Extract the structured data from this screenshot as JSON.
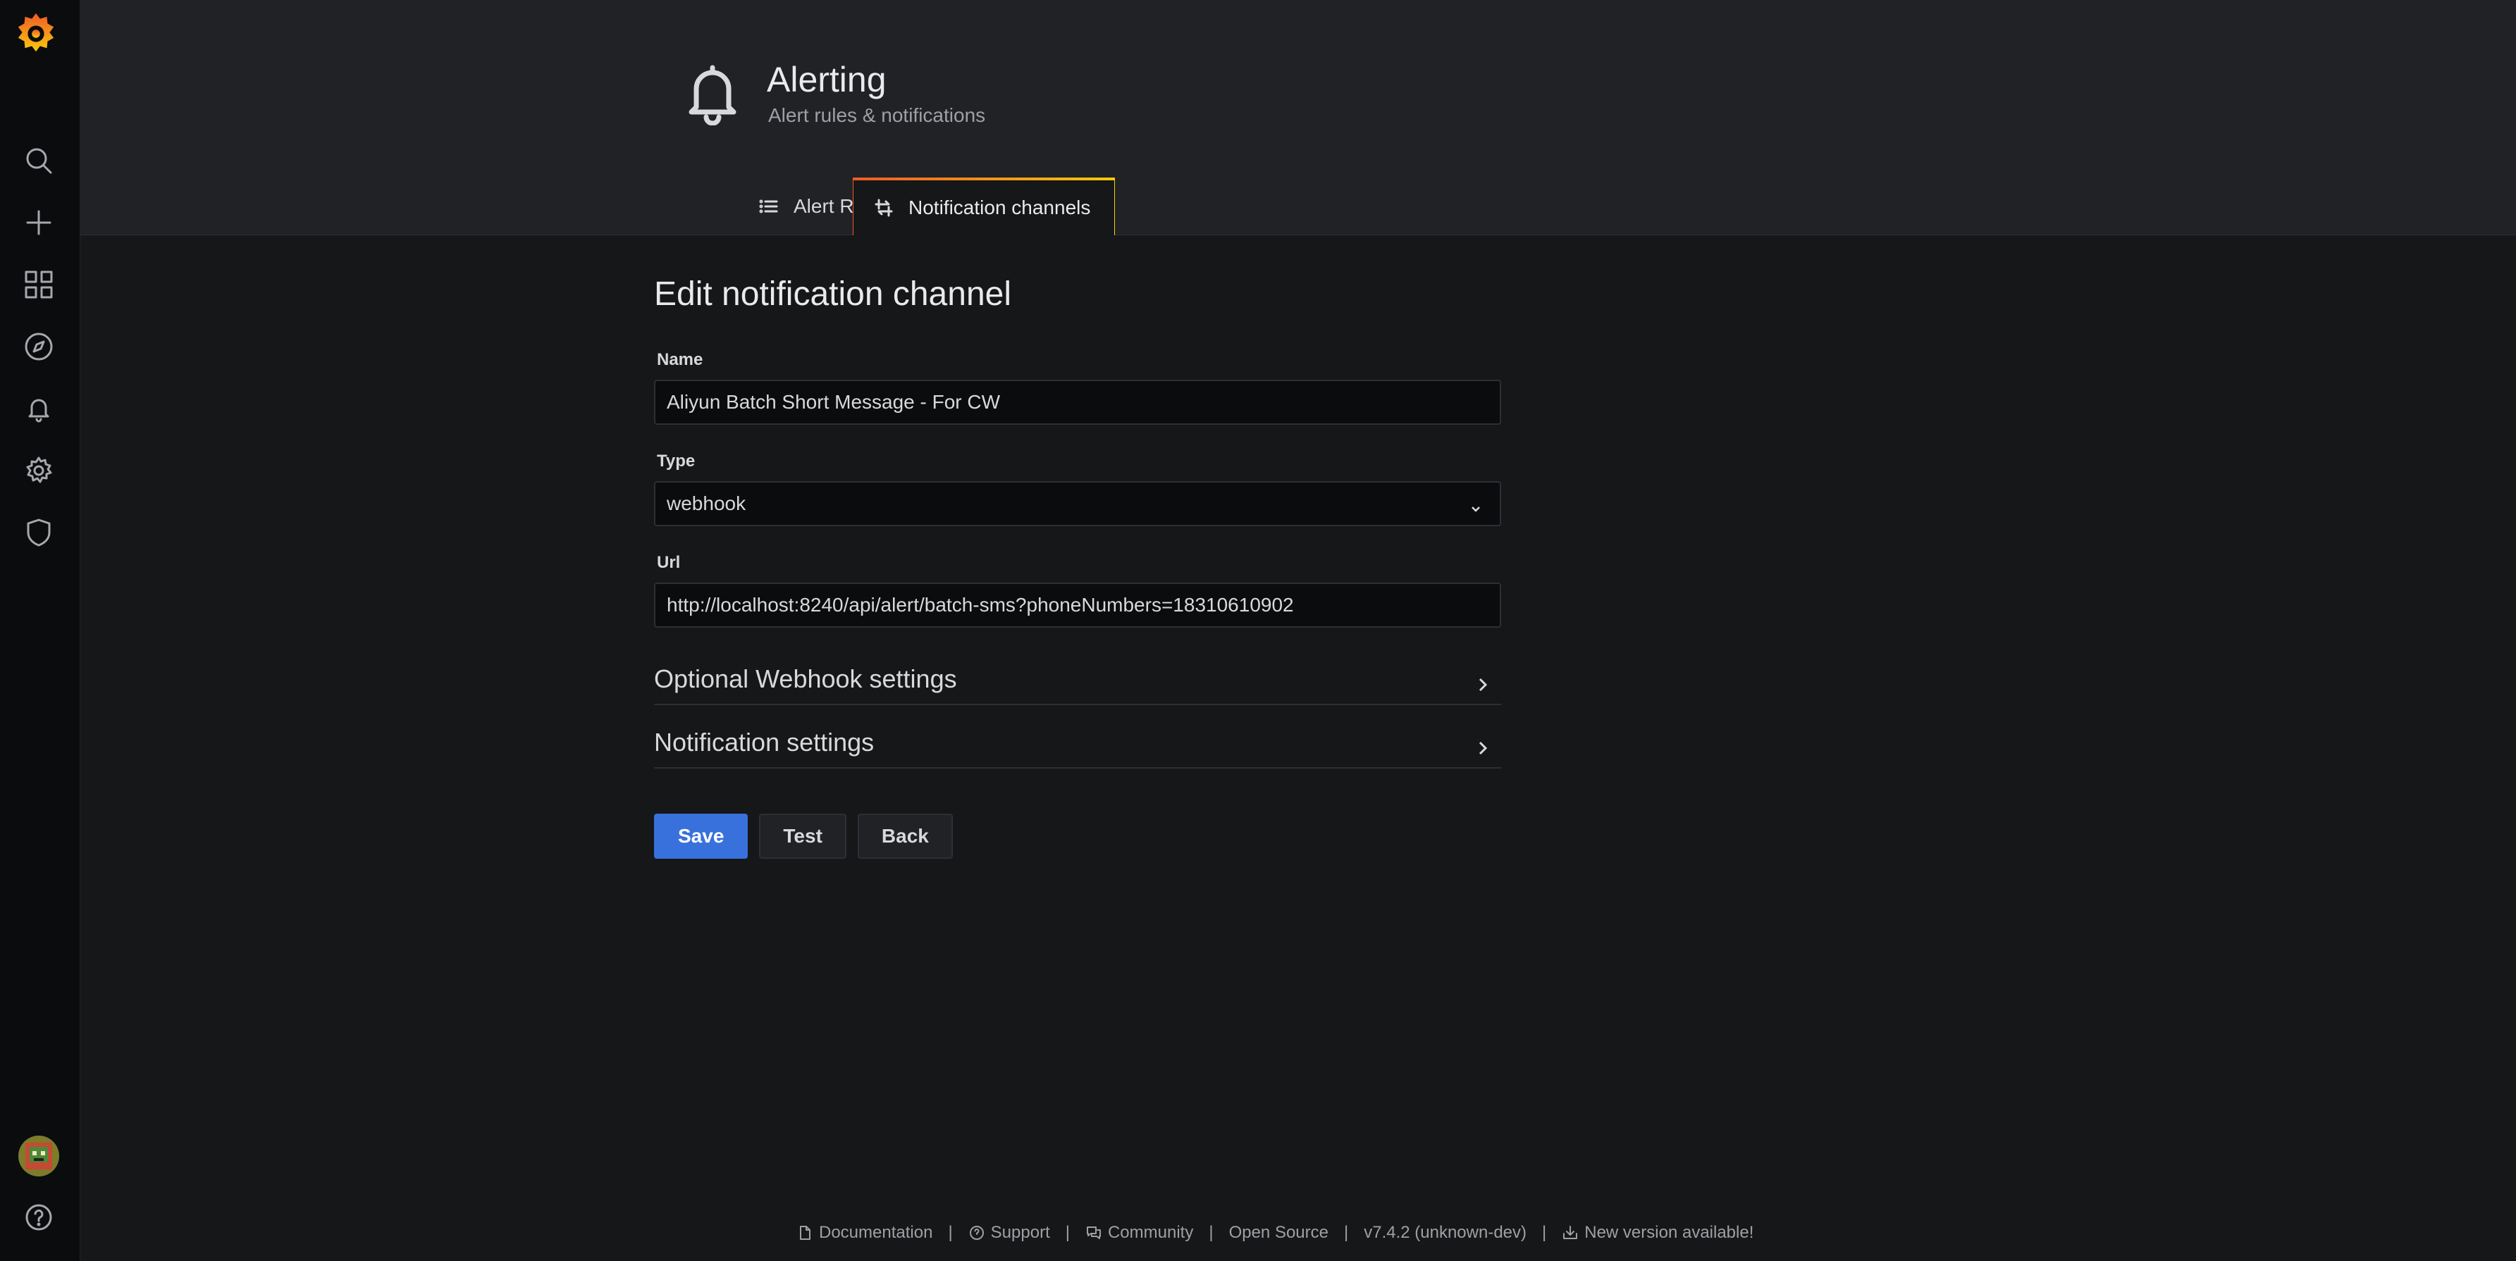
{
  "header": {
    "title": "Alerting",
    "subtitle": "Alert rules & notifications",
    "tabs": [
      {
        "label": "Alert Rules",
        "icon": "list-icon"
      },
      {
        "label": "Notification channels",
        "icon": "channels-icon"
      }
    ]
  },
  "form": {
    "title": "Edit notification channel",
    "name_label": "Name",
    "name_value": "Aliyun Batch Short Message - For CW",
    "type_label": "Type",
    "type_value": "webhook",
    "url_label": "Url",
    "url_value": "http://localhost:8240/api/alert/batch-sms?phoneNumbers=18310610902",
    "sections": [
      "Optional Webhook settings",
      "Notification settings"
    ],
    "buttons": {
      "save": "Save",
      "test": "Test",
      "back": "Back"
    }
  },
  "footer": {
    "links": [
      "Documentation",
      "Support",
      "Community",
      "Open Source",
      "v7.4.2 (unknown-dev)",
      "New version available!"
    ]
  },
  "colors": {
    "accent": "#3871dc",
    "tab_gradient_start": "#f05a28",
    "tab_gradient_end": "#fbca0a",
    "background": "#161719",
    "sidebar": "#0b0c0e"
  }
}
